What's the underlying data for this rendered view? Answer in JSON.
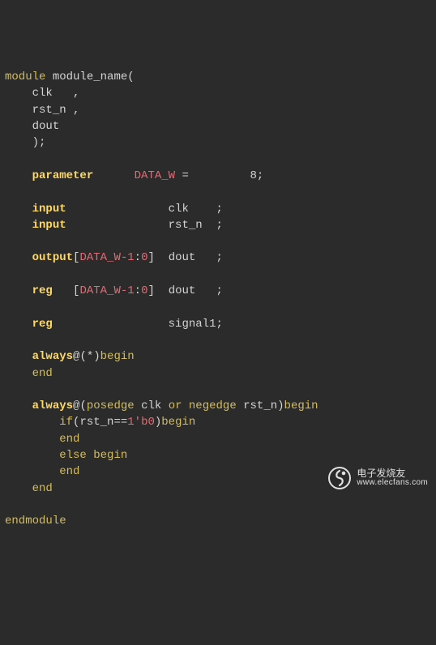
{
  "code": {
    "module_kw": "module",
    "module_name": "module_name",
    "port_clk": "clk",
    "port_rstn": "rst_n",
    "port_dout": "dout",
    "paren_close_semicolon": ");",
    "comma": ",",
    "parameter_kw": "parameter",
    "data_w": "DATA_W",
    "eq": "=",
    "param_value": "8",
    "semi": ";",
    "input_kw": "input",
    "output_kw": "output",
    "reg_kw": "reg",
    "range_open": "[",
    "range_hi": "DATA_W-1",
    "range_lo": "0",
    "range_close": "]",
    "signal1": "signal1",
    "always_kw": "always",
    "at": "@",
    "star": "(*)",
    "begin_kw": "begin",
    "end_kw": "end",
    "posedge_kw": "posedge",
    "negedge_kw": "negedge",
    "or_kw": "or",
    "if_kw": "if",
    "else_kw": "else",
    "reset_cond_open": "(",
    "reset_cond_close": ")",
    "reset_eq": "==",
    "reset_val": "1'b0",
    "endmodule_kw": "endmodule"
  },
  "watermark": {
    "cn_text": "电子发烧友",
    "url_text": "www.elecfans.com"
  }
}
